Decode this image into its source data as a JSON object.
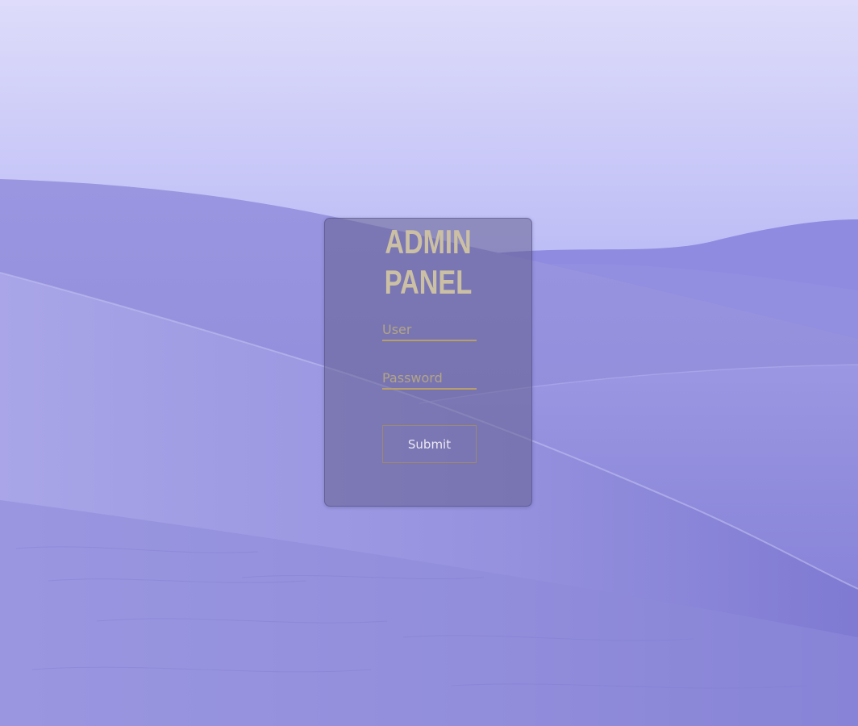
{
  "panel": {
    "title": "ADMIN PANEL"
  },
  "form": {
    "user_placeholder": "User",
    "user_value": "",
    "password_placeholder": "Password",
    "password_value": "",
    "submit_label": "Submit"
  },
  "colors": {
    "accent": "#b89f68",
    "title": "#cbc0a4",
    "sky_top": "#dcdaf8",
    "sky_horizon": "#6d7df0",
    "dunes": "#8c88dc"
  }
}
